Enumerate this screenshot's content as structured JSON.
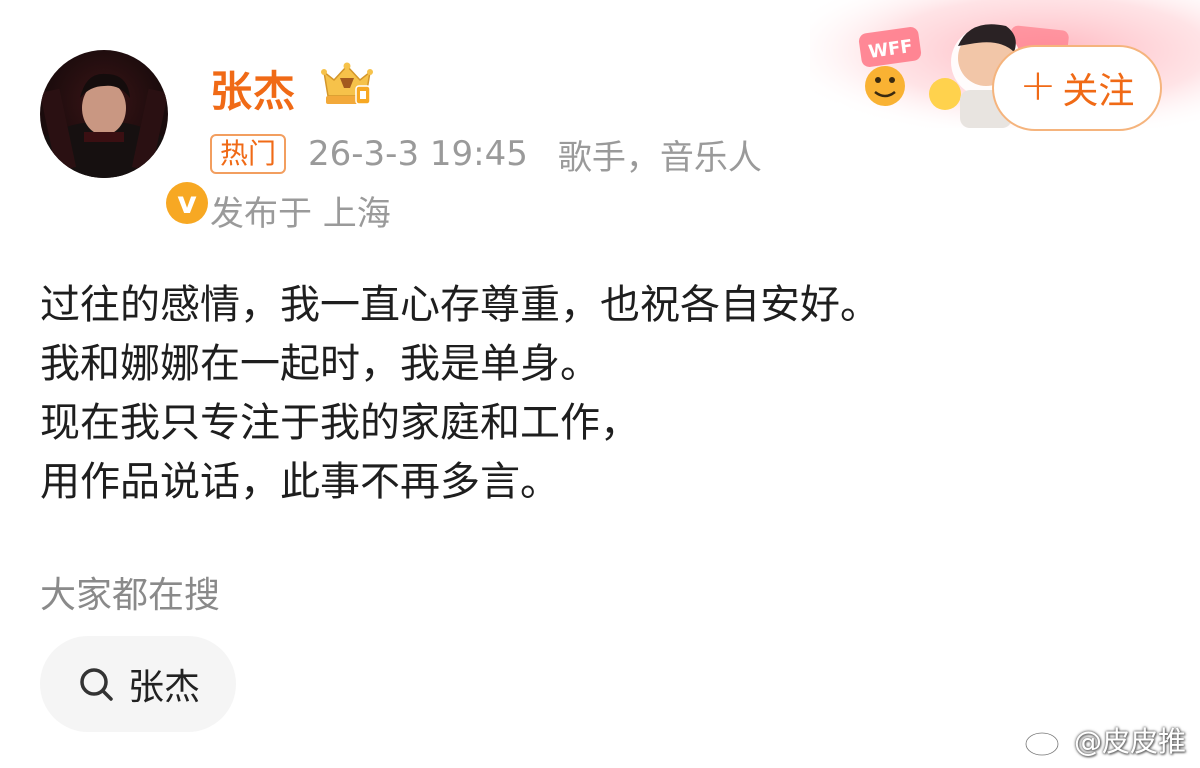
{
  "post": {
    "author": "张杰",
    "hot_tag": "热门",
    "time": "26-3-3 19:45",
    "bio": "歌手，音乐人",
    "location": "发布于 上海",
    "follow_label": "关注",
    "body_lines": [
      "过往的感情，我一直心存尊重，也祝各自安好。",
      "我和娜娜在一起时，我是单身。",
      "现在我只专注于我的家庭和工作，",
      "用作品说话，此事不再多言。"
    ]
  },
  "banner": {
    "badge_text": "WFF"
  },
  "search": {
    "heading": "大家都在搜",
    "chip_label": "张杰"
  },
  "watermark": {
    "text": "@皮皮推"
  },
  "colors": {
    "accent": "#f06a16",
    "muted": "#9a9a9a",
    "chip_bg": "#f5f5f5",
    "verified": "#f7a823"
  },
  "icons": [
    "verified-badge-icon",
    "crown-badge-icon",
    "plus-icon",
    "search-icon",
    "weibo-logo-icon"
  ]
}
